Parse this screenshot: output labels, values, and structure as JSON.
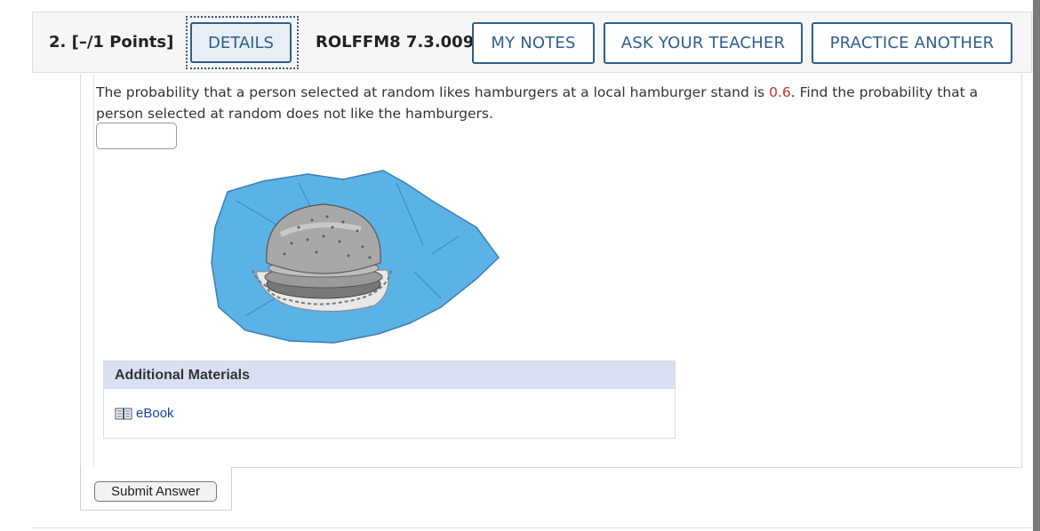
{
  "header": {
    "question_number": "2. [–/1 Points]",
    "details_label": "DETAILS",
    "problem_code": "ROLFFM8 7.3.009.",
    "my_notes_label": "MY NOTES",
    "ask_teacher_label": "ASK YOUR TEACHER",
    "practice_label": "PRACTICE ANOTHER"
  },
  "question": {
    "text_before": "The probability that a person selected at random likes hamburgers at a local hamburger stand is ",
    "value": "0.6",
    "text_after": ". Find the probability that a person selected at random does not like the hamburgers.",
    "answer_value": "",
    "image_subject": "hamburger-on-blue-wrapper"
  },
  "materials": {
    "heading": "Additional Materials",
    "ebook_label": "eBook",
    "ebook_icon": "book-icon"
  },
  "submit": {
    "label": "Submit Answer"
  },
  "colors": {
    "accent": "#2e5f8a",
    "value_red": "#c8312b",
    "materials_header": "#d9e0f2",
    "link": "#1a3fa0"
  }
}
